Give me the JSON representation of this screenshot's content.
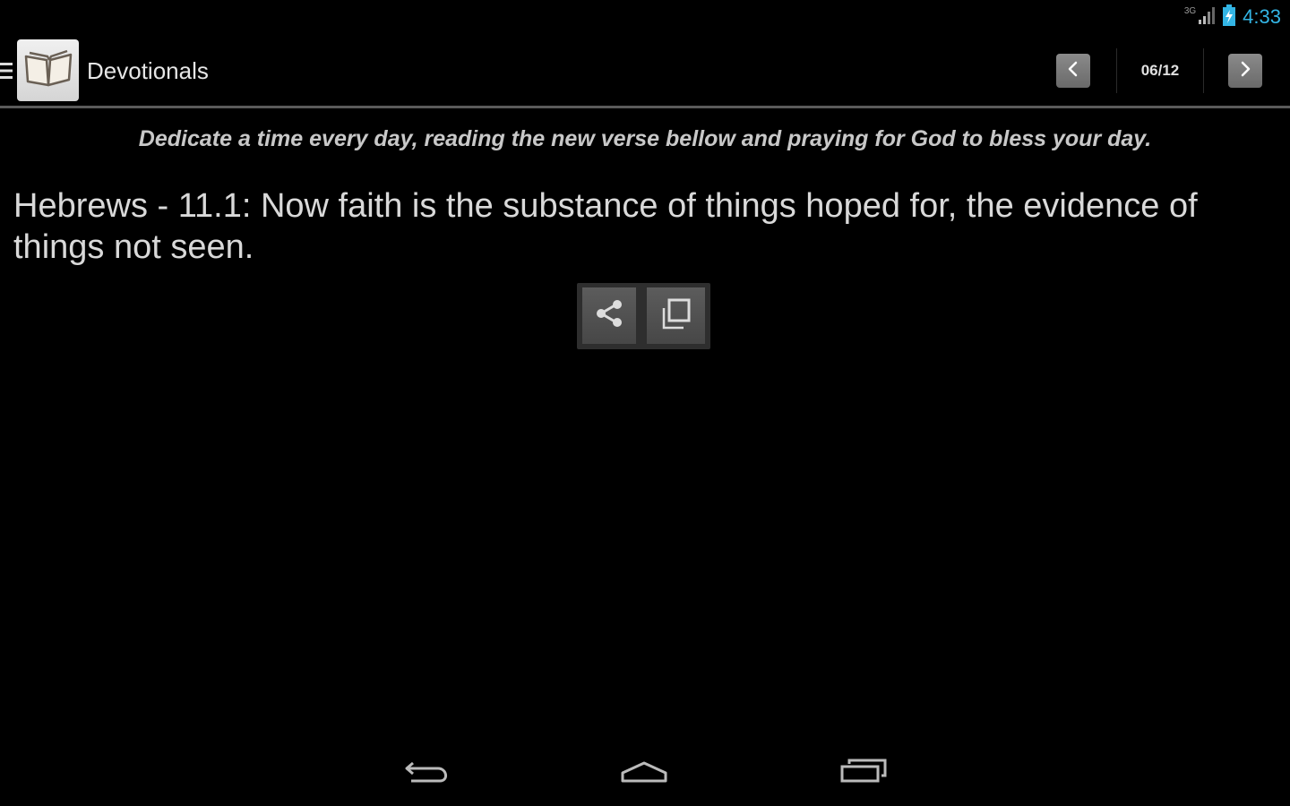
{
  "status_bar": {
    "network_type": "3G",
    "clock": "4:33",
    "icons": [
      "signal-icon",
      "battery-charging-icon"
    ],
    "clock_color": "#33b5e5"
  },
  "action_bar": {
    "title": "Devotionals",
    "page_counter": "06/12",
    "icons": [
      "drawer-icon",
      "book-icon",
      "chevron-left-icon",
      "chevron-right-icon"
    ]
  },
  "content": {
    "subtitle": "Dedicate a time every day, reading the new verse bellow and praying for God to bless your day.",
    "verse": "Hebrews - 11.1: Now faith is the substance of things hoped for, the evidence of things not seen.",
    "actions": [
      "share-icon",
      "copy-icon"
    ]
  },
  "nav_bar": {
    "icons": [
      "back-icon",
      "home-icon",
      "recents-icon"
    ]
  }
}
